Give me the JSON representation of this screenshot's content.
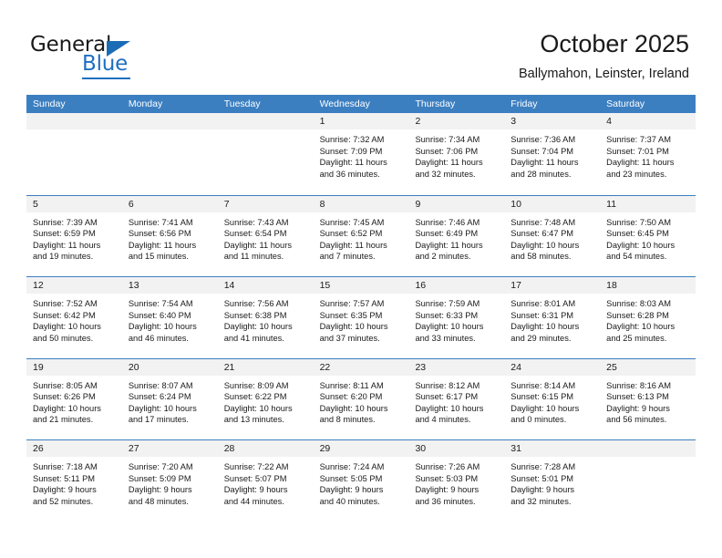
{
  "brand": {
    "name_part1": "General",
    "name_part2": "Blue",
    "accent_color": "#1f6fc0",
    "triangle_color": "#1a6cb5"
  },
  "header": {
    "title": "October 2025",
    "subtitle": "Ballymahon, Leinster, Ireland"
  },
  "calendar": {
    "header_bg": "#3c7fc1",
    "day_band_bg": "#f2f2f2",
    "weekdays": [
      "Sunday",
      "Monday",
      "Tuesday",
      "Wednesday",
      "Thursday",
      "Friday",
      "Saturday"
    ],
    "weeks": [
      [
        {
          "day": "",
          "empty": true,
          "sunrise": "",
          "sunset": "",
          "daylight_line1": "",
          "daylight_line2": ""
        },
        {
          "day": "",
          "empty": true,
          "sunrise": "",
          "sunset": "",
          "daylight_line1": "",
          "daylight_line2": ""
        },
        {
          "day": "",
          "empty": true,
          "sunrise": "",
          "sunset": "",
          "daylight_line1": "",
          "daylight_line2": ""
        },
        {
          "day": "1",
          "empty": false,
          "sunrise": "Sunrise: 7:32 AM",
          "sunset": "Sunset: 7:09 PM",
          "daylight_line1": "Daylight: 11 hours",
          "daylight_line2": "and 36 minutes."
        },
        {
          "day": "2",
          "empty": false,
          "sunrise": "Sunrise: 7:34 AM",
          "sunset": "Sunset: 7:06 PM",
          "daylight_line1": "Daylight: 11 hours",
          "daylight_line2": "and 32 minutes."
        },
        {
          "day": "3",
          "empty": false,
          "sunrise": "Sunrise: 7:36 AM",
          "sunset": "Sunset: 7:04 PM",
          "daylight_line1": "Daylight: 11 hours",
          "daylight_line2": "and 28 minutes."
        },
        {
          "day": "4",
          "empty": false,
          "sunrise": "Sunrise: 7:37 AM",
          "sunset": "Sunset: 7:01 PM",
          "daylight_line1": "Daylight: 11 hours",
          "daylight_line2": "and 23 minutes."
        }
      ],
      [
        {
          "day": "5",
          "empty": false,
          "sunrise": "Sunrise: 7:39 AM",
          "sunset": "Sunset: 6:59 PM",
          "daylight_line1": "Daylight: 11 hours",
          "daylight_line2": "and 19 minutes."
        },
        {
          "day": "6",
          "empty": false,
          "sunrise": "Sunrise: 7:41 AM",
          "sunset": "Sunset: 6:56 PM",
          "daylight_line1": "Daylight: 11 hours",
          "daylight_line2": "and 15 minutes."
        },
        {
          "day": "7",
          "empty": false,
          "sunrise": "Sunrise: 7:43 AM",
          "sunset": "Sunset: 6:54 PM",
          "daylight_line1": "Daylight: 11 hours",
          "daylight_line2": "and 11 minutes."
        },
        {
          "day": "8",
          "empty": false,
          "sunrise": "Sunrise: 7:45 AM",
          "sunset": "Sunset: 6:52 PM",
          "daylight_line1": "Daylight: 11 hours",
          "daylight_line2": "and 7 minutes."
        },
        {
          "day": "9",
          "empty": false,
          "sunrise": "Sunrise: 7:46 AM",
          "sunset": "Sunset: 6:49 PM",
          "daylight_line1": "Daylight: 11 hours",
          "daylight_line2": "and 2 minutes."
        },
        {
          "day": "10",
          "empty": false,
          "sunrise": "Sunrise: 7:48 AM",
          "sunset": "Sunset: 6:47 PM",
          "daylight_line1": "Daylight: 10 hours",
          "daylight_line2": "and 58 minutes."
        },
        {
          "day": "11",
          "empty": false,
          "sunrise": "Sunrise: 7:50 AM",
          "sunset": "Sunset: 6:45 PM",
          "daylight_line1": "Daylight: 10 hours",
          "daylight_line2": "and 54 minutes."
        }
      ],
      [
        {
          "day": "12",
          "empty": false,
          "sunrise": "Sunrise: 7:52 AM",
          "sunset": "Sunset: 6:42 PM",
          "daylight_line1": "Daylight: 10 hours",
          "daylight_line2": "and 50 minutes."
        },
        {
          "day": "13",
          "empty": false,
          "sunrise": "Sunrise: 7:54 AM",
          "sunset": "Sunset: 6:40 PM",
          "daylight_line1": "Daylight: 10 hours",
          "daylight_line2": "and 46 minutes."
        },
        {
          "day": "14",
          "empty": false,
          "sunrise": "Sunrise: 7:56 AM",
          "sunset": "Sunset: 6:38 PM",
          "daylight_line1": "Daylight: 10 hours",
          "daylight_line2": "and 41 minutes."
        },
        {
          "day": "15",
          "empty": false,
          "sunrise": "Sunrise: 7:57 AM",
          "sunset": "Sunset: 6:35 PM",
          "daylight_line1": "Daylight: 10 hours",
          "daylight_line2": "and 37 minutes."
        },
        {
          "day": "16",
          "empty": false,
          "sunrise": "Sunrise: 7:59 AM",
          "sunset": "Sunset: 6:33 PM",
          "daylight_line1": "Daylight: 10 hours",
          "daylight_line2": "and 33 minutes."
        },
        {
          "day": "17",
          "empty": false,
          "sunrise": "Sunrise: 8:01 AM",
          "sunset": "Sunset: 6:31 PM",
          "daylight_line1": "Daylight: 10 hours",
          "daylight_line2": "and 29 minutes."
        },
        {
          "day": "18",
          "empty": false,
          "sunrise": "Sunrise: 8:03 AM",
          "sunset": "Sunset: 6:28 PM",
          "daylight_line1": "Daylight: 10 hours",
          "daylight_line2": "and 25 minutes."
        }
      ],
      [
        {
          "day": "19",
          "empty": false,
          "sunrise": "Sunrise: 8:05 AM",
          "sunset": "Sunset: 6:26 PM",
          "daylight_line1": "Daylight: 10 hours",
          "daylight_line2": "and 21 minutes."
        },
        {
          "day": "20",
          "empty": false,
          "sunrise": "Sunrise: 8:07 AM",
          "sunset": "Sunset: 6:24 PM",
          "daylight_line1": "Daylight: 10 hours",
          "daylight_line2": "and 17 minutes."
        },
        {
          "day": "21",
          "empty": false,
          "sunrise": "Sunrise: 8:09 AM",
          "sunset": "Sunset: 6:22 PM",
          "daylight_line1": "Daylight: 10 hours",
          "daylight_line2": "and 13 minutes."
        },
        {
          "day": "22",
          "empty": false,
          "sunrise": "Sunrise: 8:11 AM",
          "sunset": "Sunset: 6:20 PM",
          "daylight_line1": "Daylight: 10 hours",
          "daylight_line2": "and 8 minutes."
        },
        {
          "day": "23",
          "empty": false,
          "sunrise": "Sunrise: 8:12 AM",
          "sunset": "Sunset: 6:17 PM",
          "daylight_line1": "Daylight: 10 hours",
          "daylight_line2": "and 4 minutes."
        },
        {
          "day": "24",
          "empty": false,
          "sunrise": "Sunrise: 8:14 AM",
          "sunset": "Sunset: 6:15 PM",
          "daylight_line1": "Daylight: 10 hours",
          "daylight_line2": "and 0 minutes."
        },
        {
          "day": "25",
          "empty": false,
          "sunrise": "Sunrise: 8:16 AM",
          "sunset": "Sunset: 6:13 PM",
          "daylight_line1": "Daylight: 9 hours",
          "daylight_line2": "and 56 minutes."
        }
      ],
      [
        {
          "day": "26",
          "empty": false,
          "sunrise": "Sunrise: 7:18 AM",
          "sunset": "Sunset: 5:11 PM",
          "daylight_line1": "Daylight: 9 hours",
          "daylight_line2": "and 52 minutes."
        },
        {
          "day": "27",
          "empty": false,
          "sunrise": "Sunrise: 7:20 AM",
          "sunset": "Sunset: 5:09 PM",
          "daylight_line1": "Daylight: 9 hours",
          "daylight_line2": "and 48 minutes."
        },
        {
          "day": "28",
          "empty": false,
          "sunrise": "Sunrise: 7:22 AM",
          "sunset": "Sunset: 5:07 PM",
          "daylight_line1": "Daylight: 9 hours",
          "daylight_line2": "and 44 minutes."
        },
        {
          "day": "29",
          "empty": false,
          "sunrise": "Sunrise: 7:24 AM",
          "sunset": "Sunset: 5:05 PM",
          "daylight_line1": "Daylight: 9 hours",
          "daylight_line2": "and 40 minutes."
        },
        {
          "day": "30",
          "empty": false,
          "sunrise": "Sunrise: 7:26 AM",
          "sunset": "Sunset: 5:03 PM",
          "daylight_line1": "Daylight: 9 hours",
          "daylight_line2": "and 36 minutes."
        },
        {
          "day": "31",
          "empty": false,
          "sunrise": "Sunrise: 7:28 AM",
          "sunset": "Sunset: 5:01 PM",
          "daylight_line1": "Daylight: 9 hours",
          "daylight_line2": "and 32 minutes."
        },
        {
          "day": "",
          "empty": true,
          "sunrise": "",
          "sunset": "",
          "daylight_line1": "",
          "daylight_line2": ""
        }
      ]
    ]
  }
}
